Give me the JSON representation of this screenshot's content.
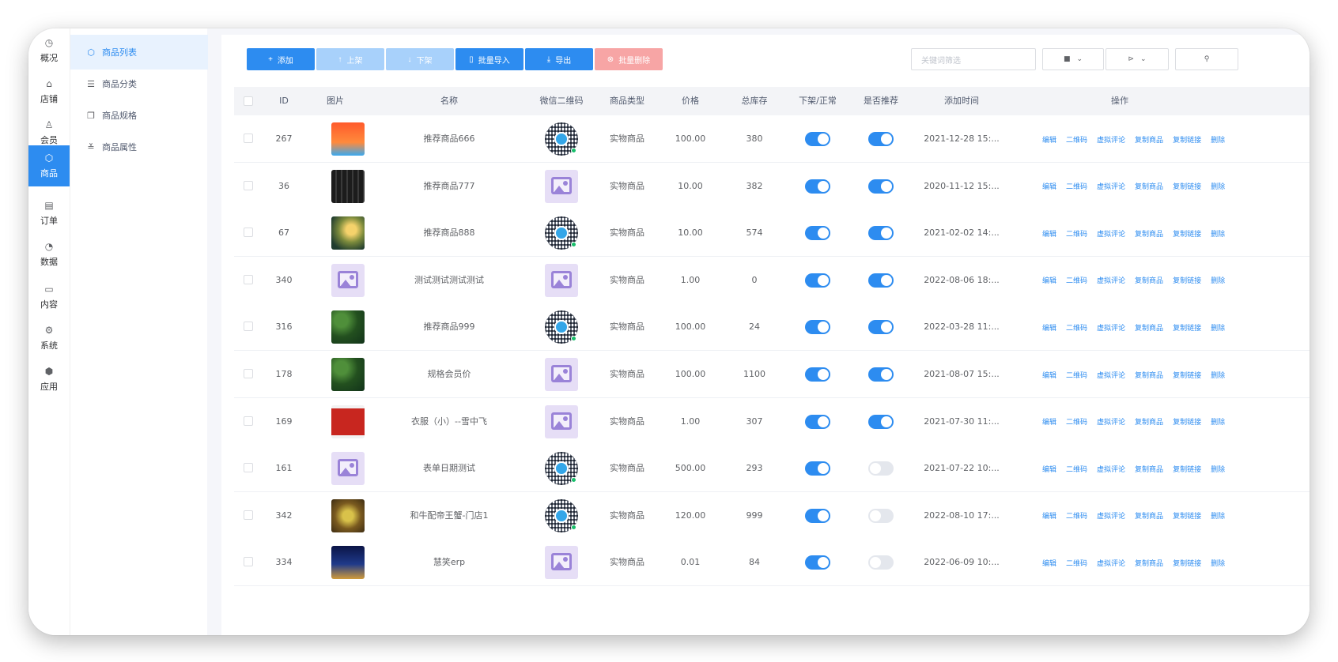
{
  "rail": [
    {
      "icon": "clock-icon",
      "glyph": "◷",
      "label": "概况"
    },
    {
      "icon": "store-icon",
      "glyph": "⌂",
      "label": "店铺"
    },
    {
      "icon": "user-icon",
      "glyph": "♙",
      "label": "会员"
    },
    {
      "icon": "box-icon",
      "glyph": "⬡",
      "label": "商品",
      "active": true
    },
    {
      "icon": "order-icon",
      "glyph": "▤",
      "label": "订单"
    },
    {
      "icon": "chart-icon",
      "glyph": "◔",
      "label": "数据"
    },
    {
      "icon": "folder-icon",
      "glyph": "▭",
      "label": "内容"
    },
    {
      "icon": "gear-icon",
      "glyph": "⚙",
      "label": "系统"
    },
    {
      "icon": "app-icon",
      "glyph": "⬢",
      "label": "应用"
    }
  ],
  "submenu": [
    {
      "icon": "box-icon",
      "glyph": "⬡",
      "label": "商品列表",
      "active": true
    },
    {
      "icon": "list-icon",
      "glyph": "☰",
      "label": "商品分类"
    },
    {
      "icon": "copy-icon",
      "glyph": "❐",
      "label": "商品规格"
    },
    {
      "icon": "sliders-icon",
      "glyph": "≚",
      "label": "商品属性"
    }
  ],
  "toolbar": {
    "add": "添加",
    "on_shelf": "上架",
    "off_shelf": "下架",
    "batch_import": "批量导入",
    "export": "导出",
    "batch_delete": "批量删除",
    "search_placeholder": "关键词筛选"
  },
  "columns": {
    "id": "ID",
    "image": "图片",
    "name": "名称",
    "wechat_qr": "微信二维码",
    "type": "商品类型",
    "price": "价格",
    "stock": "总库存",
    "status": "下架/正常",
    "recommend": "是否推荐",
    "added_time": "添加时间",
    "actions": "操作"
  },
  "actions": [
    "编辑",
    "二维码",
    "虚拟评论",
    "复制商品",
    "复制链接",
    "删除"
  ],
  "rows": [
    {
      "id": "267",
      "image": "app-poster",
      "name": "推荐商品666",
      "qr": "qr",
      "type": "实物商品",
      "price": "100.00",
      "stock": "380",
      "status": true,
      "recommend": true,
      "time": "2021-12-28 15:..."
    },
    {
      "id": "36",
      "image": "keyboard",
      "name": "推荐商品777",
      "qr": "placeholder",
      "type": "实物商品",
      "price": "10.00",
      "stock": "382",
      "status": true,
      "recommend": true,
      "time": "2020-11-12 15:..."
    },
    {
      "id": "67",
      "image": "landscape",
      "name": "推荐商品888",
      "qr": "qr",
      "type": "实物商品",
      "price": "10.00",
      "stock": "574",
      "status": true,
      "recommend": true,
      "time": "2021-02-02 14:..."
    },
    {
      "id": "340",
      "image": "placeholder",
      "name": "测试测试测试测试",
      "qr": "placeholder",
      "type": "实物商品",
      "price": "1.00",
      "stock": "0",
      "status": true,
      "recommend": true,
      "time": "2022-08-06 18:..."
    },
    {
      "id": "316",
      "image": "greenery",
      "name": "推荐商品999",
      "qr": "qr",
      "type": "实物商品",
      "price": "100.00",
      "stock": "24",
      "status": true,
      "recommend": true,
      "time": "2022-03-28 11:..."
    },
    {
      "id": "178",
      "image": "greenery",
      "name": "规格会员价",
      "qr": "placeholder",
      "type": "实物商品",
      "price": "100.00",
      "stock": "1100",
      "status": true,
      "recommend": true,
      "time": "2021-08-07 15:..."
    },
    {
      "id": "169",
      "image": "red-poster",
      "name": "衣服（小）--雪中飞",
      "qr": "placeholder",
      "type": "实物商品",
      "price": "1.00",
      "stock": "307",
      "status": true,
      "recommend": true,
      "time": "2021-07-30 11:..."
    },
    {
      "id": "161",
      "image": "placeholder",
      "name": "表单日期测试",
      "qr": "qr",
      "type": "实物商品",
      "price": "500.00",
      "stock": "293",
      "status": true,
      "recommend": false,
      "time": "2021-07-22 10:..."
    },
    {
      "id": "342",
      "image": "crab",
      "name": "和牛配帝王蟹-门店1",
      "qr": "qr",
      "type": "实物商品",
      "price": "120.00",
      "stock": "999",
      "status": true,
      "recommend": false,
      "time": "2022-08-10 17:..."
    },
    {
      "id": "334",
      "image": "building",
      "name": "慧笑erp",
      "qr": "placeholder",
      "type": "实物商品",
      "price": "0.01",
      "stock": "84",
      "status": true,
      "recommend": false,
      "time": "2022-06-09 10:..."
    }
  ],
  "colors": {
    "primary": "#2d8cf0",
    "primary_light": "#a8d1fb",
    "danger_light": "#f7a5a5"
  }
}
